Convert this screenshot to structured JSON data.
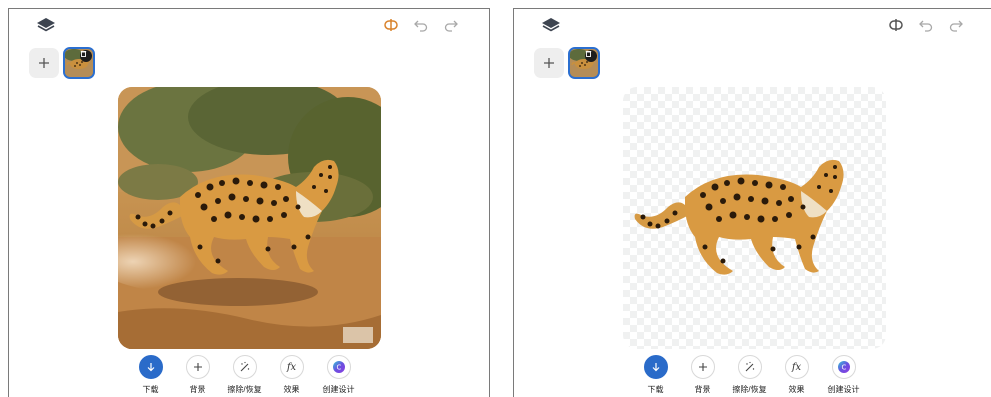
{
  "panels": [
    {
      "id": "original",
      "actions": [
        {
          "label": "下载",
          "icon": "download-icon"
        },
        {
          "label": "背景",
          "icon": "plus-icon"
        },
        {
          "label": "擦除/恢复",
          "icon": "magic-wand-icon"
        },
        {
          "label": "效果",
          "icon": "fx-icon"
        },
        {
          "label": "创建设计",
          "icon": "design-logo-icon"
        }
      ],
      "compare_active": true
    },
    {
      "id": "background-removed",
      "actions": [
        {
          "label": "下载",
          "icon": "download-icon"
        },
        {
          "label": "背景",
          "icon": "plus-icon"
        },
        {
          "label": "擦除/恢复",
          "icon": "magic-wand-icon"
        },
        {
          "label": "效果",
          "icon": "fx-icon"
        },
        {
          "label": "创建设计",
          "icon": "design-logo-icon"
        }
      ],
      "compare_active": false
    }
  ],
  "toolbar": {
    "icons": [
      "layers-icon",
      "compare-icon",
      "undo-icon",
      "redo-icon"
    ],
    "fx_glyph": "fx"
  },
  "colors": {
    "accent": "#2a6bc9",
    "compare_active": "#d9822b",
    "icon_gray": "#9a9a9a"
  }
}
